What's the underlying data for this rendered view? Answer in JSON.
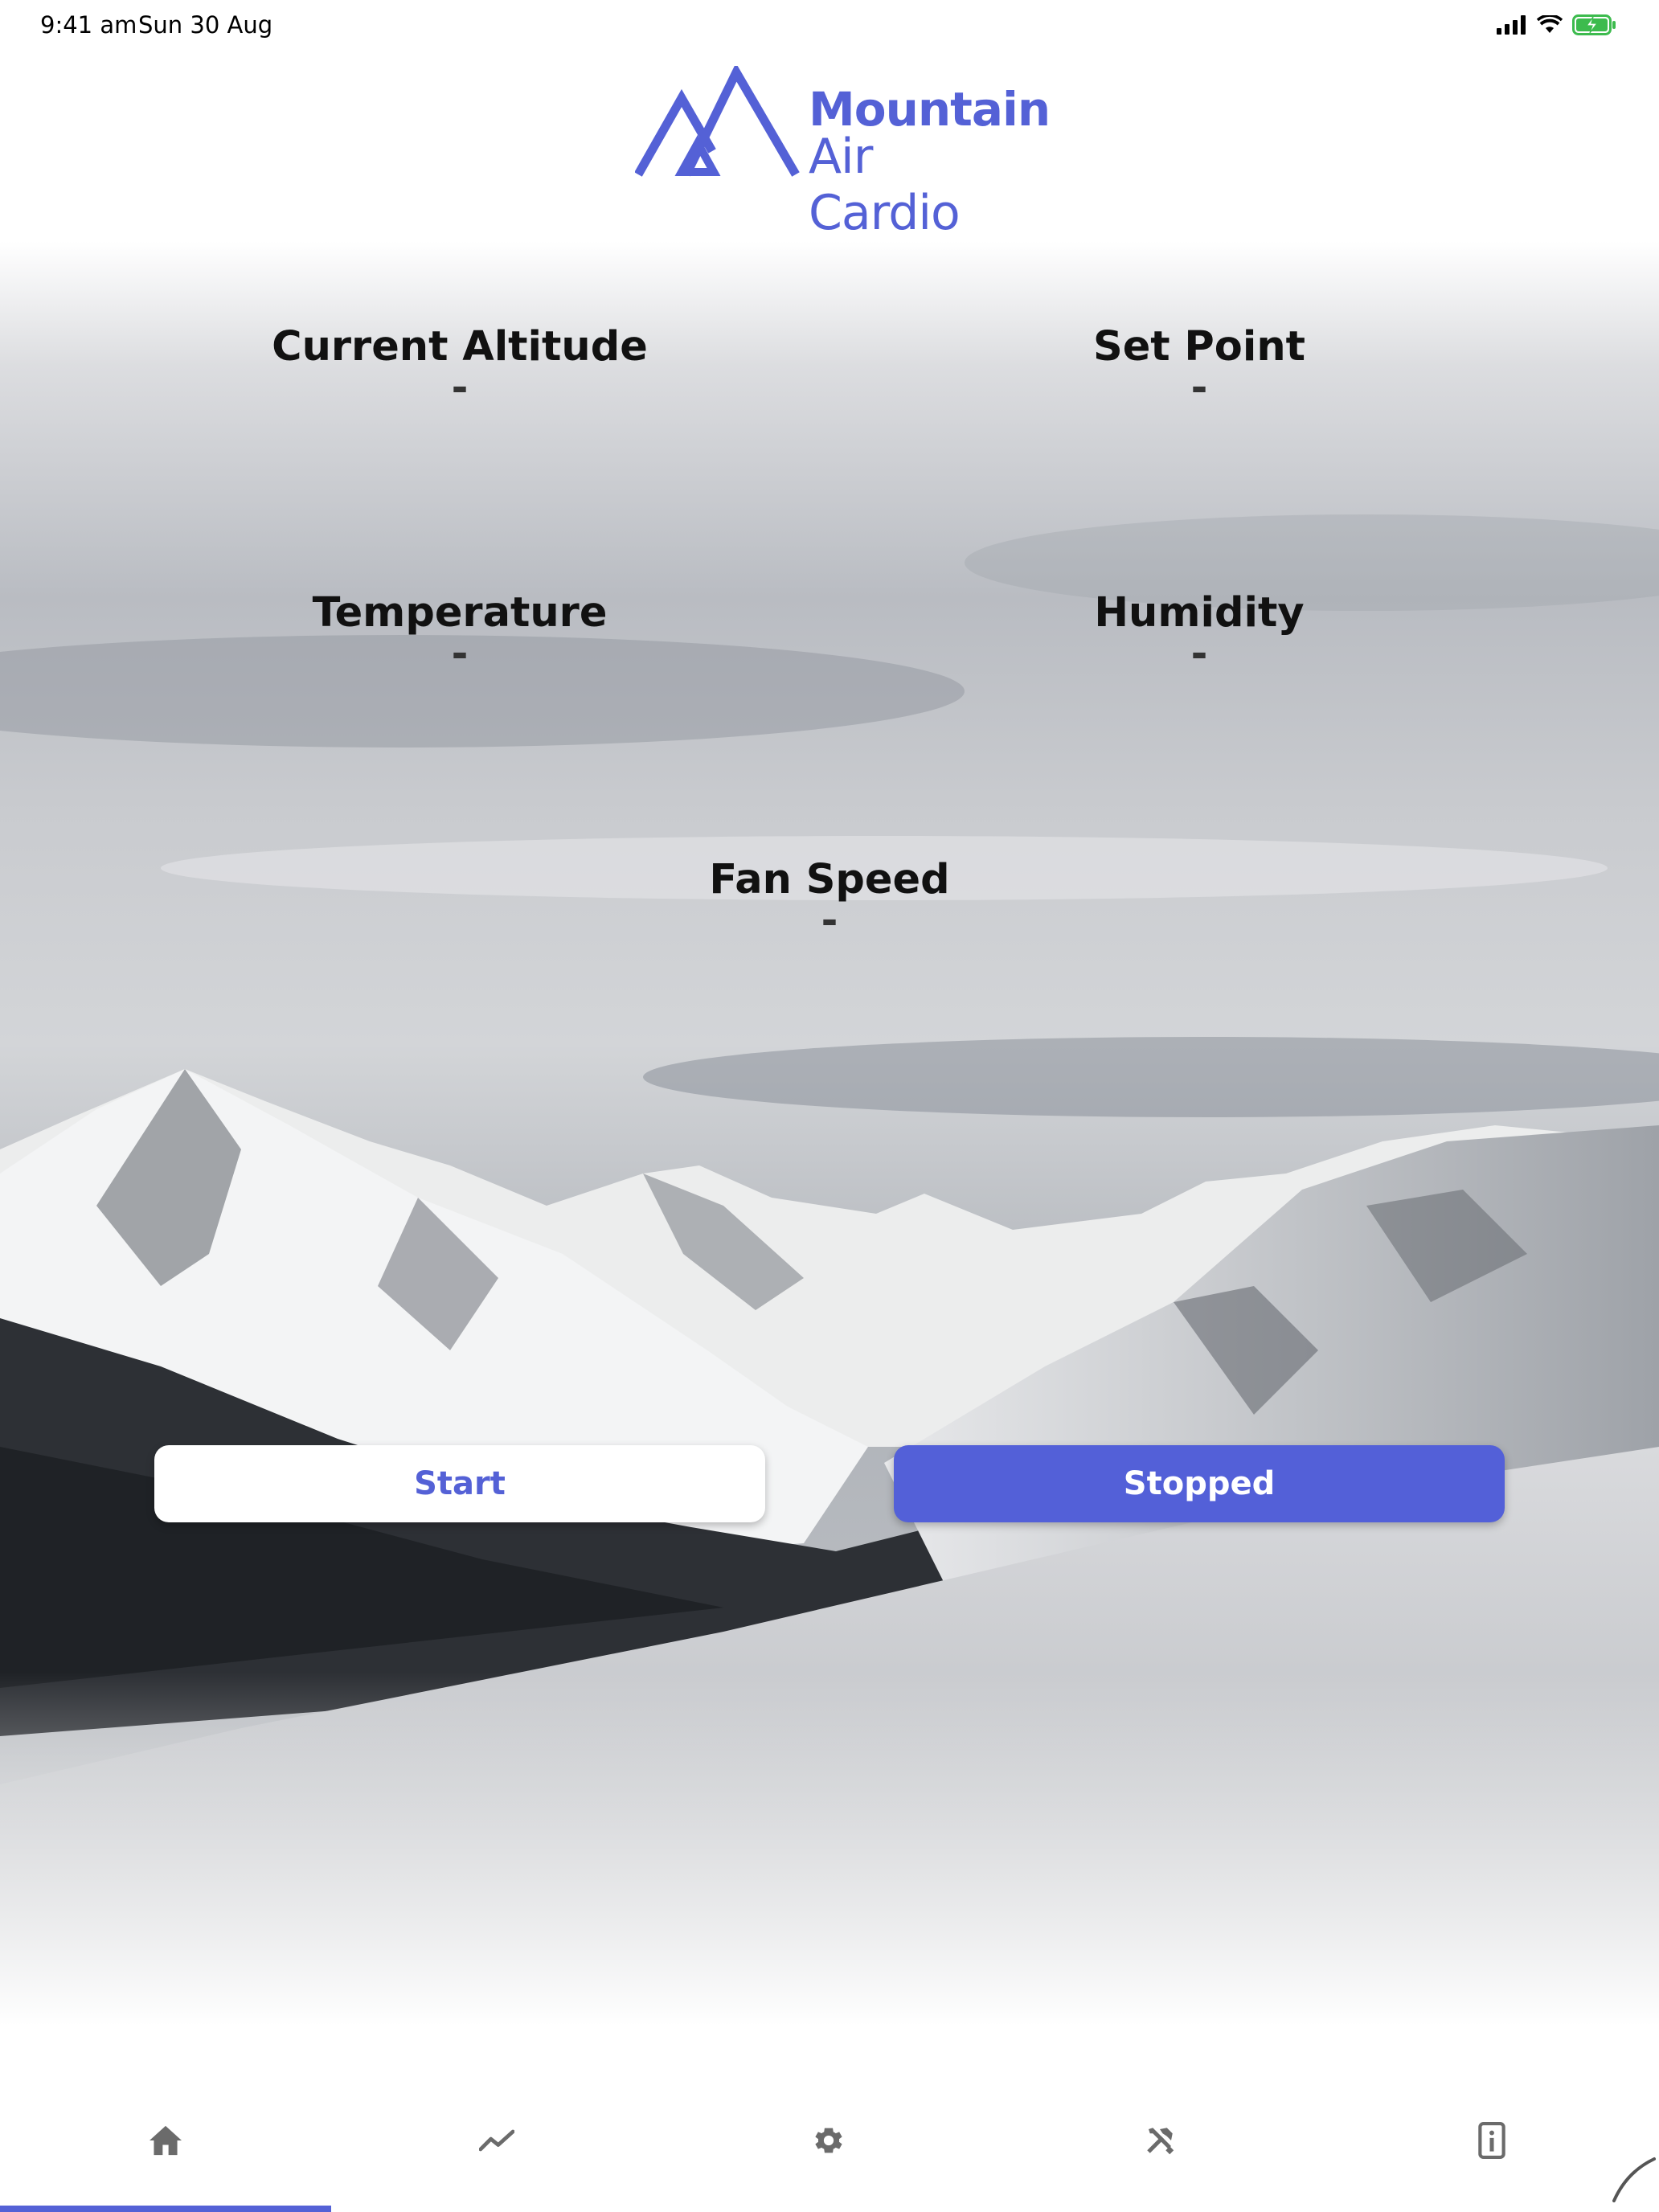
{
  "status_bar": {
    "time": "9:41 am",
    "date": "Sun 30 Aug",
    "icons": [
      "signal-icon",
      "wifi-icon",
      "battery-charging-icon"
    ]
  },
  "logo": {
    "line1": "Mountain",
    "line2": "Air Cardio",
    "brand_color": "#5461d6"
  },
  "metrics": {
    "current_altitude": {
      "label": "Current Altitude",
      "value": "-"
    },
    "set_point": {
      "label": "Set Point",
      "value": "-"
    },
    "temperature": {
      "label": "Temperature",
      "value": "-"
    },
    "humidity": {
      "label": "Humidity",
      "value": "-"
    },
    "fan_speed": {
      "label": "Fan Speed",
      "value": "-"
    }
  },
  "controls": {
    "start_label": "Start",
    "stop_label": "Stopped",
    "accent_color": "#5360d8"
  },
  "tabbar": {
    "tabs": [
      {
        "icon": "home-icon",
        "selected": true
      },
      {
        "icon": "trend-chart-icon",
        "selected": false
      },
      {
        "icon": "gear-icon",
        "selected": false
      },
      {
        "icon": "tools-icon",
        "selected": false
      },
      {
        "icon": "device-info-icon",
        "selected": false
      }
    ]
  }
}
